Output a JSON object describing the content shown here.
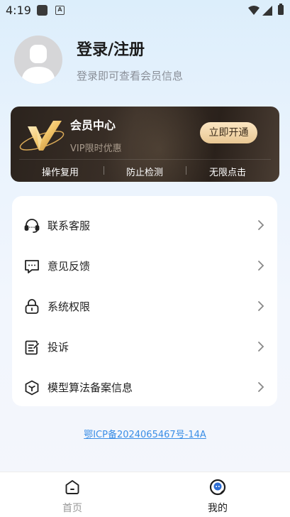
{
  "status_bar": {
    "time": "4:19",
    "app_badge": "A"
  },
  "profile": {
    "title": "登录/注册",
    "subtitle": "登录即可查看会员信息"
  },
  "vip": {
    "title": "会员中心",
    "subtitle": "VIP限时优惠",
    "button_label": "立即开通",
    "features": [
      "操作复用",
      "防止检测",
      "无限点击"
    ]
  },
  "menu": {
    "items": [
      {
        "label": "联系客服",
        "icon": "headset-icon"
      },
      {
        "label": "意见反馈",
        "icon": "chat-bubble-icon"
      },
      {
        "label": "系统权限",
        "icon": "lock-icon"
      },
      {
        "label": "投诉",
        "icon": "complaint-icon"
      },
      {
        "label": "模型算法备案信息",
        "icon": "cube-icon"
      }
    ]
  },
  "footer": {
    "icp": "鄂ICP备2024065467号-14A"
  },
  "bottom_nav": {
    "items": [
      {
        "label": "首页",
        "icon": "home-icon",
        "active": false
      },
      {
        "label": "我的",
        "icon": "profile-icon",
        "active": true
      }
    ]
  },
  "colors": {
    "vip_button": "#f1d7a9",
    "link": "#3a8ee6",
    "active_nav": "#1c1c1c",
    "inactive_nav": "#999999"
  }
}
